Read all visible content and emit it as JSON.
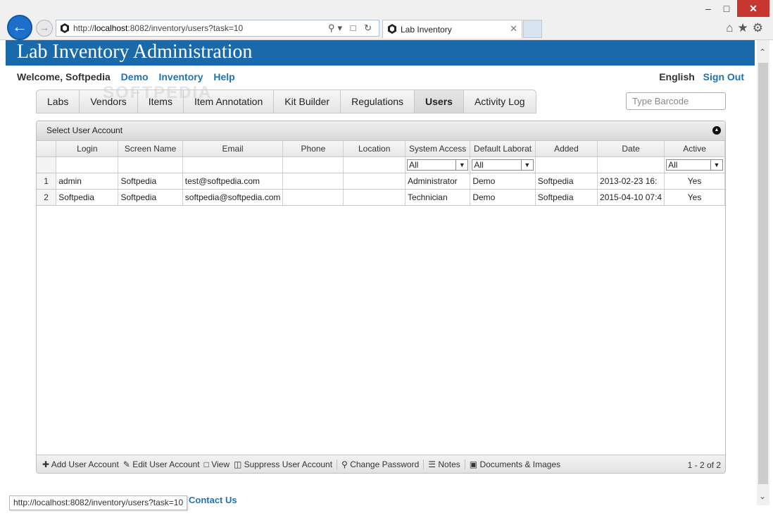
{
  "browser": {
    "url_prefix": "http://",
    "url_host": "localhost",
    "url_rest": ":8082/inventory/users?task=10",
    "tab_title": "Lab Inventory",
    "status_url": "http://localhost:8082/inventory/users?task=10"
  },
  "header": {
    "title": "Lab Inventory Administration",
    "welcome": "Welcome, Softpedia",
    "nav": [
      "Demo",
      "Inventory",
      "Help"
    ],
    "language": "English",
    "sign_out": "Sign Out",
    "barcode_placeholder": "Type Barcode",
    "watermark": "SOFTPEDIA"
  },
  "tabs": [
    "Labs",
    "Vendors",
    "Items",
    "Item Annotation",
    "Kit Builder",
    "Regulations",
    "Users",
    "Activity Log"
  ],
  "active_tab": "Users",
  "grid": {
    "caption": "Select User Account",
    "columns": [
      "Login",
      "Screen Name",
      "Email",
      "Phone",
      "Location",
      "System Access",
      "Default Laborat",
      "Added",
      "Date",
      "Active"
    ],
    "filter_value": "All",
    "rows": [
      {
        "n": "1",
        "login": "admin",
        "screen": "Softpedia",
        "email": "test@softpedia.com",
        "phone": "",
        "location": "",
        "access": "Administrator",
        "lab": "Demo",
        "added": "Softpedia",
        "date": "2013-02-23 16:",
        "active": "Yes"
      },
      {
        "n": "2",
        "login": "Softpedia",
        "screen": "Softpedia",
        "email": "softpedia@softpedia.com",
        "phone": "",
        "location": "",
        "access": "Technician",
        "lab": "Demo",
        "added": "Softpedia",
        "date": "2015-04-10 07:4",
        "active": "Yes"
      }
    ],
    "actions": {
      "add": "Add User Account",
      "edit": "Edit User Account",
      "view": "View",
      "suppress": "Suppress User Account",
      "password": "Change Password",
      "notes": "Notes",
      "docs": "Documents & Images"
    },
    "pager": "1 - 2 of 2"
  },
  "footer": {
    "contact": "Contact Us"
  }
}
